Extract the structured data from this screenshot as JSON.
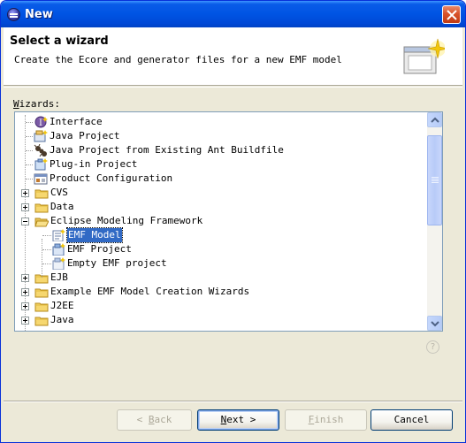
{
  "window": {
    "title": "New"
  },
  "header": {
    "title": "Select a wizard",
    "description": "Create the Ecore and generator files for a new EMF model"
  },
  "wizards_label": {
    "mnemonic": "W",
    "rest": "izards:"
  },
  "tree": {
    "items": [
      {
        "label": "Interface",
        "icon": "interface-icon",
        "depth": 1
      },
      {
        "label": "Java Project",
        "icon": "java-project-icon",
        "depth": 1
      },
      {
        "label": "Java Project from Existing Ant Buildfile",
        "icon": "ant-icon",
        "depth": 1
      },
      {
        "label": "Plug-in Project",
        "icon": "plugin-project-icon",
        "depth": 1
      },
      {
        "label": "Product Configuration",
        "icon": "product-config-icon",
        "depth": 1
      },
      {
        "label": "CVS",
        "icon": "folder-icon",
        "depth": 0,
        "expanded": false
      },
      {
        "label": "Data",
        "icon": "folder-icon",
        "depth": 0,
        "expanded": false
      },
      {
        "label": "Eclipse Modeling Framework",
        "icon": "folder-open-icon",
        "depth": 0,
        "expanded": true
      },
      {
        "label": "EMF Model",
        "icon": "emf-model-icon",
        "depth": 1,
        "selected": true
      },
      {
        "label": "EMF Project",
        "icon": "emf-project-icon",
        "depth": 1
      },
      {
        "label": "Empty EMF project",
        "icon": "empty-emf-project-icon",
        "depth": 1
      },
      {
        "label": "EJB",
        "icon": "folder-icon",
        "depth": 0,
        "expanded": false
      },
      {
        "label": "Example EMF Model Creation Wizards",
        "icon": "folder-icon",
        "depth": 0,
        "expanded": false
      },
      {
        "label": "J2EE",
        "icon": "folder-icon",
        "depth": 0,
        "expanded": false
      },
      {
        "label": "Java",
        "icon": "folder-icon",
        "depth": 0,
        "expanded": false
      }
    ]
  },
  "buttons": {
    "back": {
      "mnemonic": "B",
      "rest": "ack",
      "prefix": "< "
    },
    "next": {
      "mnemonic": "N",
      "rest": "ext",
      "suffix": " >"
    },
    "finish": {
      "mnemonic": "F",
      "rest": "inish"
    },
    "cancel": {
      "label": "Cancel"
    }
  },
  "colors": {
    "selection": "#316ac5",
    "titlebar": "#0054e3",
    "dialog_bg": "#ece9d8"
  }
}
